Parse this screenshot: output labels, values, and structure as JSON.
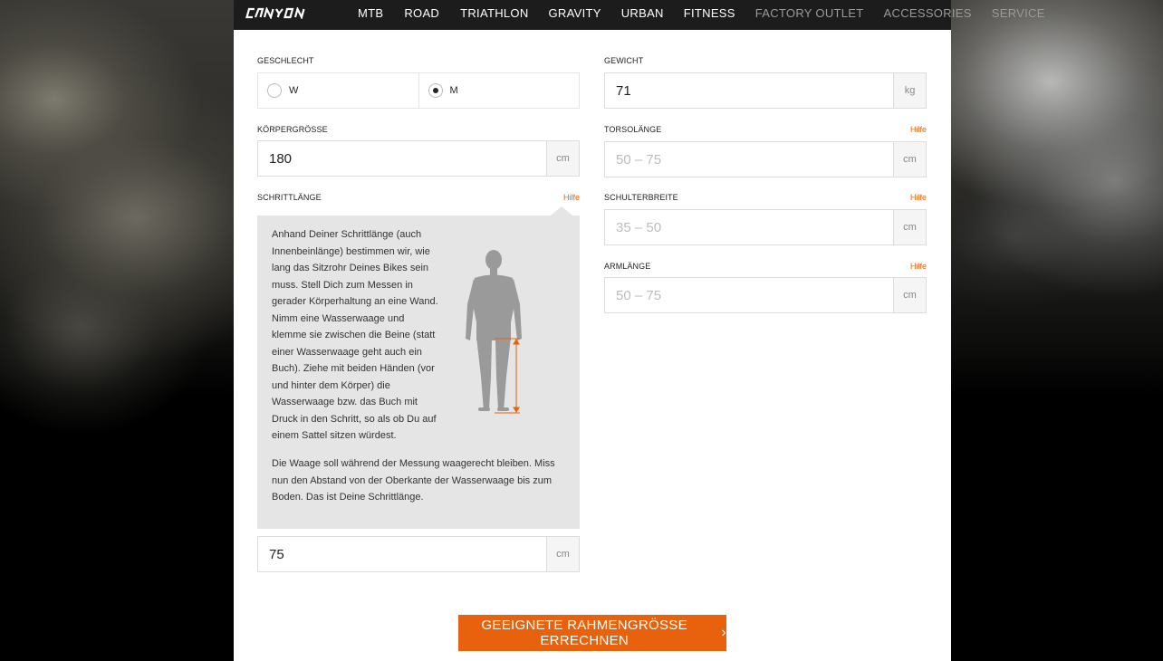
{
  "nav": {
    "logo": "CANYON",
    "items": [
      {
        "label": "MTB",
        "dim": false
      },
      {
        "label": "ROAD",
        "dim": false
      },
      {
        "label": "TRIATHLON",
        "dim": false
      },
      {
        "label": "GRAVITY",
        "dim": false
      },
      {
        "label": "URBAN",
        "dim": false
      },
      {
        "label": "FITNESS",
        "dim": false
      },
      {
        "label": "FACTORY OUTLET",
        "dim": true
      },
      {
        "label": "ACCESSORIES",
        "dim": true
      },
      {
        "label": "SERVICE",
        "dim": true
      }
    ]
  },
  "form": {
    "gender": {
      "label": "GESCHLECHT",
      "options": [
        "W",
        "M"
      ],
      "selected": "M"
    },
    "height": {
      "label": "KÖRPERGRÖSSE",
      "value": "180",
      "unit": "cm"
    },
    "inseam": {
      "label": "SCHRITTLÄNGE",
      "help": "Hilfe",
      "value": "75",
      "unit": "cm",
      "help_text_1": "Anhand Deiner Schrittlänge (auch Innenbeinlänge) bestimmen wir, wie lang das Sitzrohr Deines Bikes sein muss. Stell Dich zum Messen in gerader Körperhaltung an eine Wand. Nimm eine Wasserwaage und klemme sie zwischen die Beine (statt einer Wasserwaage geht auch ein Buch). Ziehe mit beiden Händen (vor und hinter dem Körper) die Wasserwaage bzw. das Buch mit Druck in den Schritt, so als ob Du auf einem Sattel sitzen würdest.",
      "help_text_2": "Die Waage soll während der Messung waagerecht bleiben. Miss nun den Abstand von der Oberkante der Wasserwaage bis zum Boden. Das ist Deine Schrittlänge."
    },
    "weight": {
      "label": "GEWICHT",
      "value": "71",
      "unit": "kg"
    },
    "torso": {
      "label": "TORSOLÄNGE",
      "help": "Hilfe",
      "placeholder": "50 – 75",
      "unit": "cm"
    },
    "shoulder": {
      "label": "SCHULTERBREITE",
      "help": "Hilfe",
      "placeholder": "35 – 50",
      "unit": "cm"
    },
    "arm": {
      "label": "ARMLÄNGE",
      "help": "Hilfe",
      "placeholder": "50 – 75",
      "unit": "cm"
    },
    "submit": "GEEIGNETE RAHMENGRÖSSE ERRECHNEN"
  },
  "colors": {
    "accent": "#e8620e",
    "nav_bg": "#1c1c1c",
    "help_bg": "#e5e5e5"
  },
  "icons": {
    "chevron": "chevron-right-icon",
    "figure": "body-silhouette-icon"
  }
}
